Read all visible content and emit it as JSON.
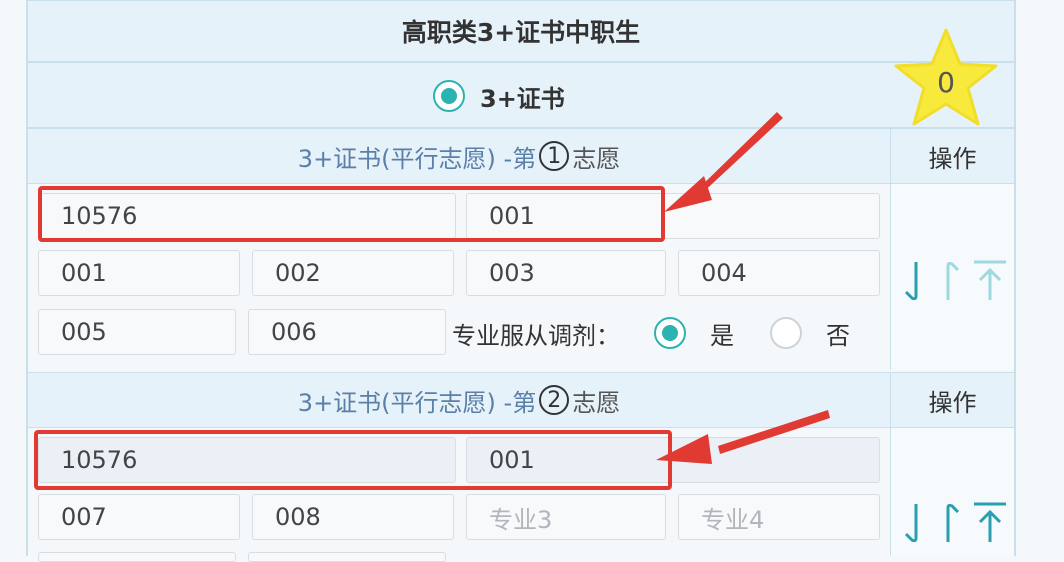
{
  "header": {
    "title": "高职类3+证书中职生"
  },
  "mode": {
    "label": "3+证书",
    "selected": true
  },
  "score": {
    "value": "0"
  },
  "groups": [
    {
      "lead": "3+证书(平行志愿) -第",
      "number": "1",
      "suffix": "志愿",
      "operation_label": "操作",
      "school_code": "10576",
      "group_code": "001",
      "majors": [
        "001",
        "002",
        "003",
        "004",
        "005",
        "006"
      ],
      "adjust_label": "专业服从调剂：",
      "adjust_yes": "是",
      "adjust_no": "否"
    },
    {
      "lead": "3+证书(平行志愿) -第",
      "number": "2",
      "suffix": "志愿",
      "operation_label": "操作",
      "school_code": "10576",
      "group_code": "001",
      "majors": [
        "007",
        "008"
      ],
      "major_placeholders": [
        "专业3",
        "专业4"
      ]
    }
  ],
  "icons": [
    "sort-down-icon",
    "sort-up-icon",
    "move-top-icon"
  ],
  "colors": {
    "accent": "#2ab3b0",
    "highlight": "#e03a32",
    "star": "#f7ea3c"
  }
}
